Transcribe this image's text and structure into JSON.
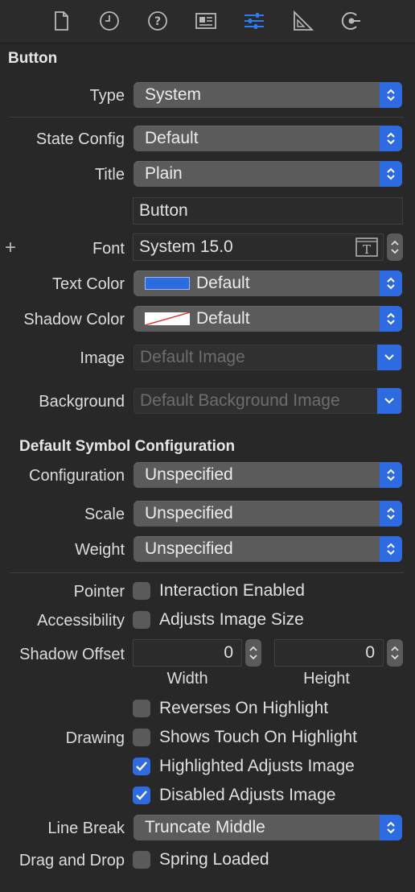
{
  "colors": {
    "accent": "#2f6be0",
    "text_color_swatch": "#2f6be0",
    "background": "#282828"
  },
  "toolbar": {
    "icons": [
      "file-icon",
      "clock-icon",
      "help-icon",
      "identity-icon",
      "attributes-icon",
      "size-icon",
      "connections-icon"
    ],
    "selected": "attributes-icon"
  },
  "button_section": {
    "title": "Button",
    "type_label": "Type",
    "type_value": "System",
    "state_config_label": "State Config",
    "state_config_value": "Default",
    "title_label": "Title",
    "title_value": "Plain",
    "title_text": "Button",
    "font_add": "+",
    "font_label": "Font",
    "font_value": "System 15.0",
    "text_color_label": "Text Color",
    "text_color_value": "Default",
    "shadow_color_label": "Shadow Color",
    "shadow_color_value": "Default",
    "image_label": "Image",
    "image_placeholder": "Default Image",
    "background_label": "Background",
    "background_placeholder": "Default Background Image"
  },
  "symbol_section": {
    "title": "Default Symbol Configuration",
    "configuration_label": "Configuration",
    "configuration_value": "Unspecified",
    "scale_label": "Scale",
    "scale_value": "Unspecified",
    "weight_label": "Weight",
    "weight_value": "Unspecified"
  },
  "behavior_section": {
    "pointer_label": "Pointer",
    "pointer_option": "Interaction Enabled",
    "pointer_checked": false,
    "accessibility_label": "Accessibility",
    "accessibility_option": "Adjusts Image Size",
    "accessibility_checked": false,
    "shadow_offset_label": "Shadow Offset",
    "shadow_offset_width": "0",
    "shadow_offset_height": "0",
    "width_label": "Width",
    "height_label": "Height",
    "drawing_label": "Drawing",
    "drawing_options": [
      {
        "label": "Reverses On Highlight",
        "checked": false
      },
      {
        "label": "Shows Touch On Highlight",
        "checked": false
      },
      {
        "label": "Highlighted Adjusts Image",
        "checked": true
      },
      {
        "label": "Disabled Adjusts Image",
        "checked": true
      }
    ],
    "line_break_label": "Line Break",
    "line_break_value": "Truncate Middle",
    "drag_drop_label": "Drag and Drop",
    "drag_drop_option": "Spring Loaded",
    "drag_drop_checked": false
  }
}
